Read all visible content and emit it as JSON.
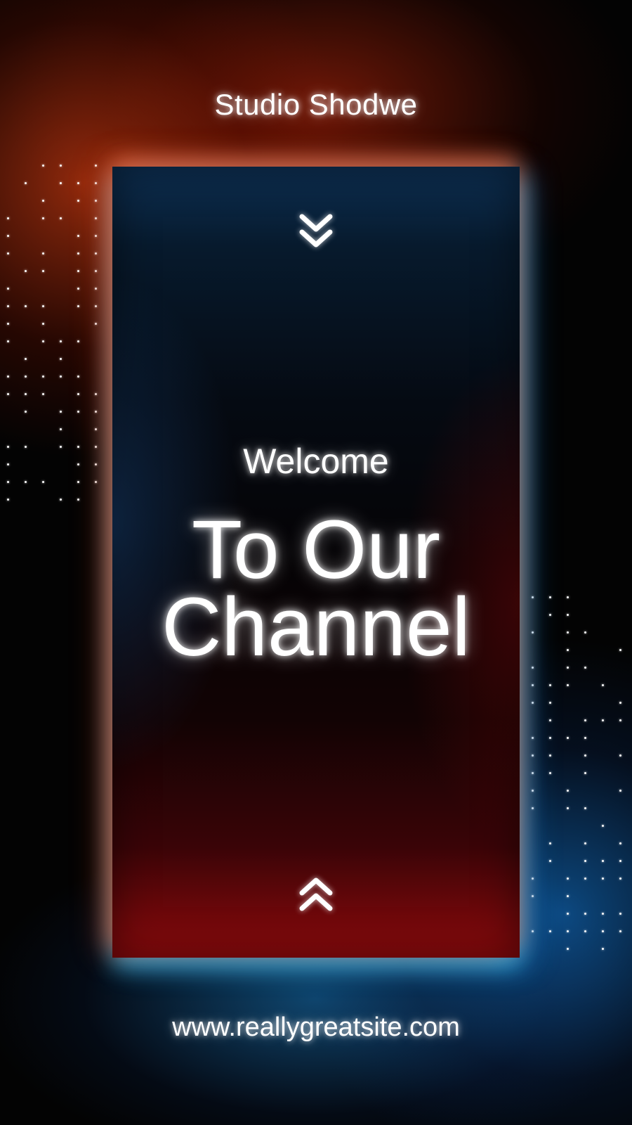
{
  "brand": {
    "name": "Studio Shodwe"
  },
  "card": {
    "welcome": "Welcome",
    "headline_line1": "To Our",
    "headline_line2": "Channel",
    "top_icon": "double-chevron-down-icon",
    "bottom_icon": "double-chevron-up-icon"
  },
  "footer": {
    "website": "www.reallygreatsite.com"
  },
  "colors": {
    "background": "#030303",
    "glow_warm": "#ff4a14",
    "glow_cool": "#1e96f0",
    "panel_top": "#0d2f52",
    "panel_bottom": "#8e0a0c",
    "text": "#ffffff"
  }
}
